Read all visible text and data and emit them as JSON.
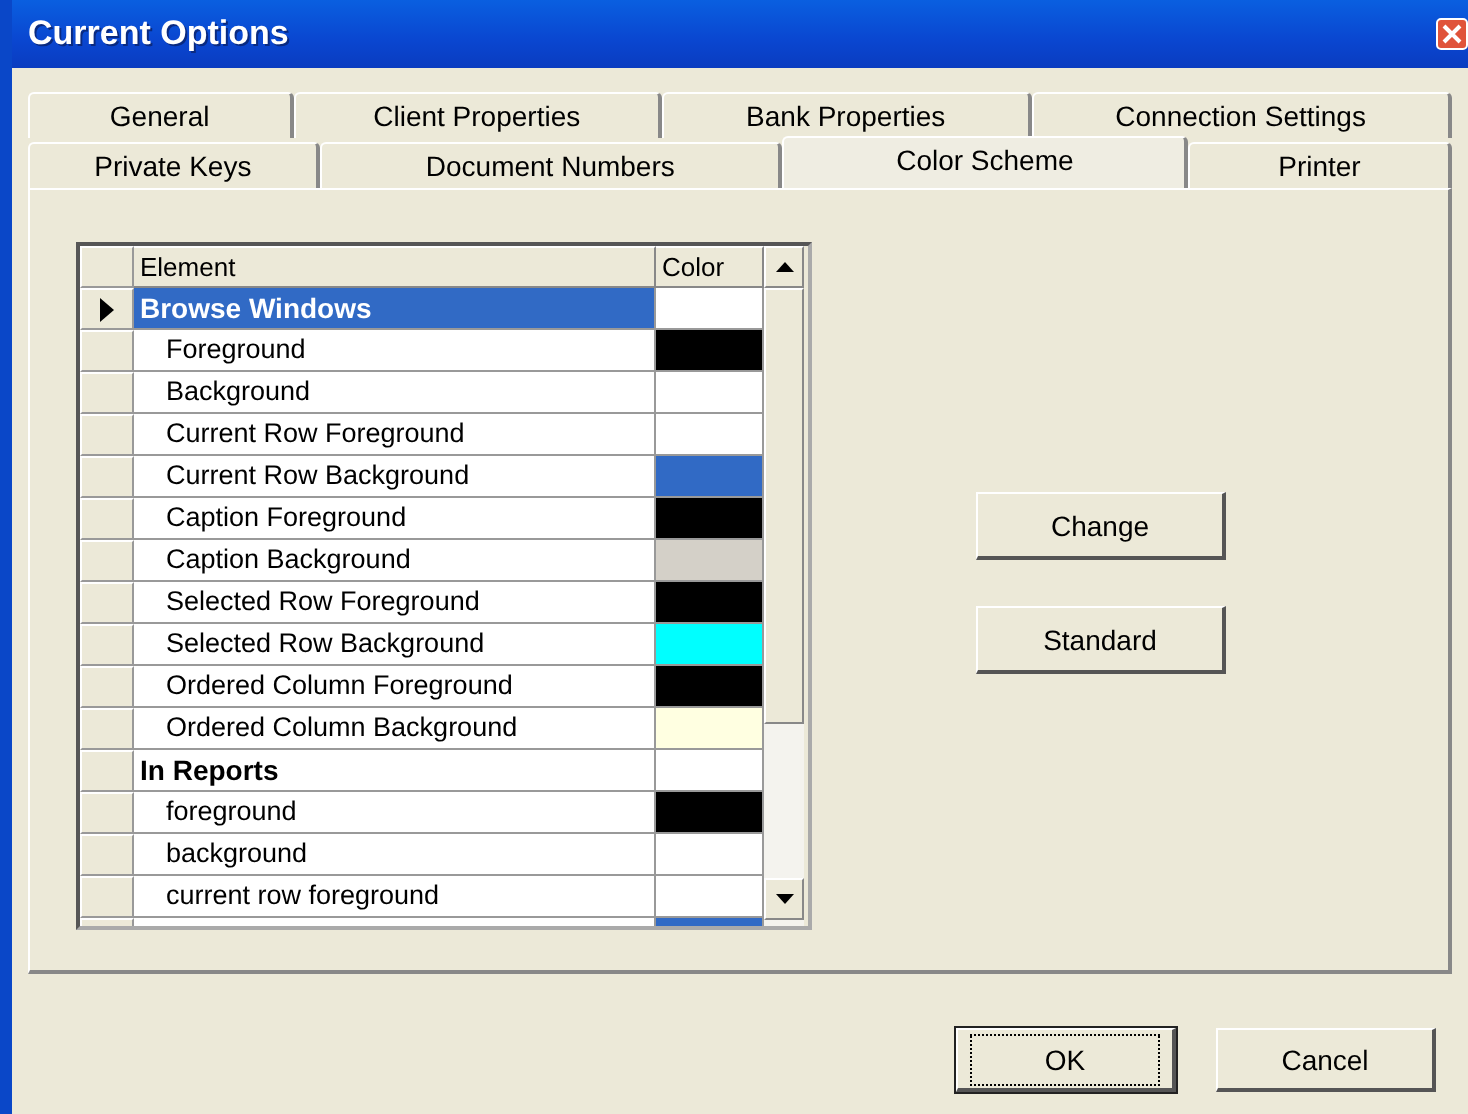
{
  "window": {
    "title": "Current Options"
  },
  "tab_rows": [
    [
      {
        "label": "General",
        "selected": false
      },
      {
        "label": "Client Properties",
        "selected": false
      },
      {
        "label": "Bank Properties",
        "selected": false
      },
      {
        "label": "Connection Settings",
        "selected": false
      }
    ],
    [
      {
        "label": "Private Keys",
        "selected": false
      },
      {
        "label": "Document Numbers",
        "selected": false
      },
      {
        "label": "Color Scheme",
        "selected": true
      },
      {
        "label": "Printer",
        "selected": false
      }
    ]
  ],
  "table": {
    "columns": [
      "Element",
      "Color"
    ],
    "rows": [
      {
        "kind": "group",
        "element": "Browse Windows",
        "color": "#ffffff",
        "selected": true
      },
      {
        "kind": "item",
        "element": "Foreground",
        "color": "#000000",
        "selected": false
      },
      {
        "kind": "item",
        "element": "Background",
        "color": "#ffffff",
        "selected": false
      },
      {
        "kind": "item",
        "element": "Current Row Foreground",
        "color": "#ffffff",
        "selected": false
      },
      {
        "kind": "item",
        "element": "Current Row Background",
        "color": "#316ac5",
        "selected": false
      },
      {
        "kind": "item",
        "element": "Caption Foreground",
        "color": "#000000",
        "selected": false
      },
      {
        "kind": "item",
        "element": "Caption Background",
        "color": "#d4d0c8",
        "selected": false
      },
      {
        "kind": "item",
        "element": "Selected Row Foreground",
        "color": "#000000",
        "selected": false
      },
      {
        "kind": "item",
        "element": "Selected Row Background",
        "color": "#00ffff",
        "selected": false
      },
      {
        "kind": "item",
        "element": "Ordered Column Foreground",
        "color": "#000000",
        "selected": false
      },
      {
        "kind": "item",
        "element": "Ordered Column Background",
        "color": "#ffffe1",
        "selected": false
      },
      {
        "kind": "group",
        "element": "In Reports",
        "color": "#ffffff",
        "selected": false
      },
      {
        "kind": "item",
        "element": "foreground",
        "color": "#000000",
        "selected": false
      },
      {
        "kind": "item",
        "element": "background",
        "color": "#ffffff",
        "selected": false
      },
      {
        "kind": "item",
        "element": "current row foreground",
        "color": "#ffffff",
        "selected": false
      },
      {
        "kind": "item",
        "color": "#316ac5",
        "selected": false
      }
    ]
  },
  "side_buttons": [
    "Change",
    "Standard"
  ],
  "buttons": [
    {
      "label": "OK",
      "default": true
    },
    {
      "label": "Cancel",
      "default": false
    }
  ]
}
